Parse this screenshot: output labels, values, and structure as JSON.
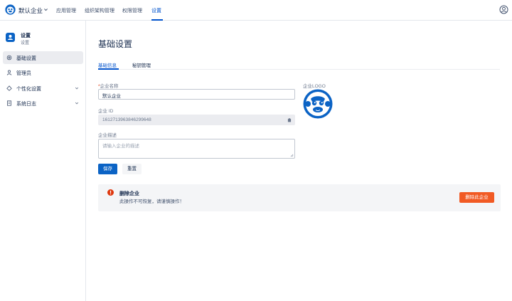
{
  "topbar": {
    "org_name": "默认企业",
    "nav": [
      "应用管理",
      "组织架构管理",
      "权限管理",
      "设置"
    ],
    "active_nav": "设置"
  },
  "sidebar": {
    "app_title": "设置",
    "app_subtitle": "设置",
    "items": [
      {
        "label": "基础设置",
        "icon": "gear-icon",
        "active": true
      },
      {
        "label": "管理员",
        "icon": "person-icon"
      },
      {
        "label": "个性化设置",
        "icon": "paint-icon",
        "expandable": true
      },
      {
        "label": "系统日志",
        "icon": "document-icon",
        "expandable": true
      }
    ]
  },
  "main": {
    "page_title": "基础设置",
    "tabs": [
      {
        "label": "基础信息",
        "active": true
      },
      {
        "label": "秘钥管理"
      }
    ],
    "form": {
      "name_required_mark": "*",
      "name_label": "企业名称",
      "name_value": "默认企业",
      "id_label": "企业 ID",
      "id_value": "1612713963846299648",
      "desc_label": "企业描述",
      "desc_placeholder": "请输入企业的描述",
      "save_label": "保存",
      "reset_label": "重置"
    },
    "logo_label": "企业LOGO",
    "danger": {
      "title": "删除企业",
      "description": "此操作不可恢复，请谨慎操作！",
      "button_label": "删除此企业"
    }
  },
  "colors": {
    "accent": "#0052cc",
    "danger": "#f15a24",
    "danger_icon": "#de350b"
  }
}
